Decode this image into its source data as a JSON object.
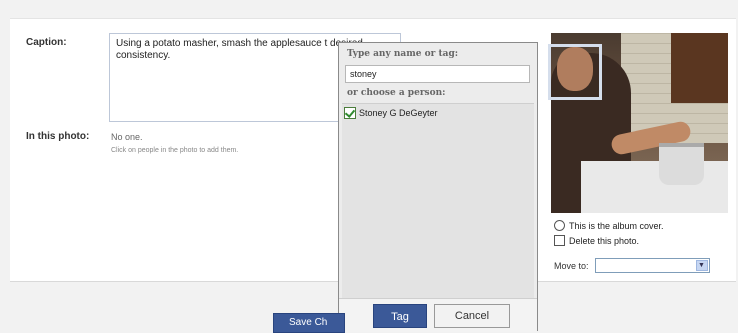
{
  "form": {
    "caption_label": "Caption:",
    "caption_text": "Using a potato masher, smash the applesauce t desired consistency.",
    "in_photo_label": "In this photo:",
    "tagged_value": "No one.",
    "tag_hint": "Click on people in the photo to add them."
  },
  "photo_options": {
    "album_cover_label": "This is the album cover.",
    "delete_label": "Delete this photo.",
    "move_to_label": "Move to:",
    "move_to_value": ""
  },
  "tag_popup": {
    "heading": "Type any name or tag:",
    "input_value": "stoney",
    "choose_label": "or choose a person:",
    "people": [
      {
        "name": "Stoney G DeGeyter",
        "checked": true
      }
    ],
    "tag_button": "Tag",
    "cancel_button": "Cancel"
  },
  "save_button": "Save Ch",
  "colors": {
    "brand_blue": "#3b5998",
    "popup_bg": "#ececec"
  }
}
